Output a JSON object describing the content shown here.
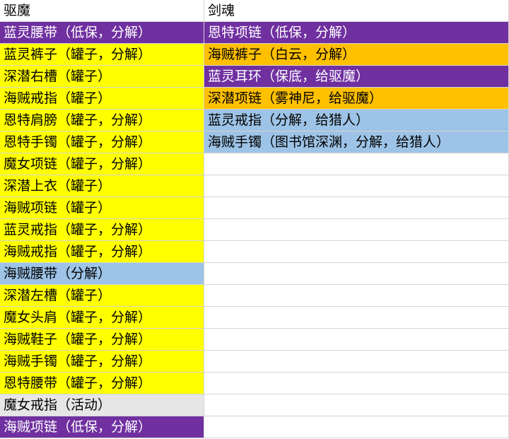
{
  "sheet": {
    "columns": [
      {
        "header": "驱魔",
        "cells": [
          {
            "text": "蓝灵腰带（低保，分解）",
            "fill": "#7030a0",
            "color": "#ffffff"
          },
          {
            "text": "蓝灵裤子（罐子，分解）",
            "fill": "#ffff00",
            "color": "#000000"
          },
          {
            "text": "深潜右槽（罐子）",
            "fill": "#ffff00",
            "color": "#000000"
          },
          {
            "text": "海贼戒指（罐子）",
            "fill": "#ffff00",
            "color": "#000000"
          },
          {
            "text": "恩特肩膀（罐子，分解）",
            "fill": "#ffff00",
            "color": "#000000"
          },
          {
            "text": "恩特手镯（罐子，分解）",
            "fill": "#ffff00",
            "color": "#000000"
          },
          {
            "text": "魔女项链（罐子，分解）",
            "fill": "#ffff00",
            "color": "#000000"
          },
          {
            "text": "深潜上衣（罐子）",
            "fill": "#ffff00",
            "color": "#000000"
          },
          {
            "text": "海贼项链（罐子）",
            "fill": "#ffff00",
            "color": "#000000"
          },
          {
            "text": "蓝灵戒指（罐子，分解）",
            "fill": "#ffff00",
            "color": "#000000"
          },
          {
            "text": "海贼戒指（罐子，分解）",
            "fill": "#ffff00",
            "color": "#000000"
          },
          {
            "text": "海贼腰带（分解）",
            "fill": "#9dc3e6",
            "color": "#000000"
          },
          {
            "text": "深潜左槽（罐子）",
            "fill": "#ffff00",
            "color": "#000000"
          },
          {
            "text": "魔女头肩（罐子，分解）",
            "fill": "#ffff00",
            "color": "#000000"
          },
          {
            "text": "海贼鞋子（罐子，分解）",
            "fill": "#ffff00",
            "color": "#000000"
          },
          {
            "text": "海贼手镯（罐子，分解）",
            "fill": "#ffff00",
            "color": "#000000"
          },
          {
            "text": "恩特腰带（罐子，分解）",
            "fill": "#ffff00",
            "color": "#000000"
          },
          {
            "text": "魔女戒指（活动）",
            "fill": "#e7e6e6",
            "color": "#000000"
          },
          {
            "text": "海贼项链（低保，分解）",
            "fill": "#7030a0",
            "color": "#ffffff"
          }
        ]
      },
      {
        "header": "剑魂",
        "cells": [
          {
            "text": "恩特项链（低保，分解）",
            "fill": "#7030a0",
            "color": "#ffffff"
          },
          {
            "text": "海贼裤子（白云，分解）",
            "fill": "#ffc000",
            "color": "#000000"
          },
          {
            "text": "蓝灵耳环（保底，给驱魔）",
            "fill": "#7030a0",
            "color": "#ffffff"
          },
          {
            "text": "深潜项链（雾神尼，给驱魔）",
            "fill": "#ffc000",
            "color": "#000000"
          },
          {
            "text": "蓝灵戒指（分解，给猎人）",
            "fill": "#9dc3e6",
            "color": "#000000"
          },
          {
            "text": "海贼手镯（图书馆深渊，分解，给猎人）",
            "fill": "#9dc3e6",
            "color": "#000000"
          },
          {
            "text": "",
            "fill": "#ffffff",
            "color": "#000000"
          },
          {
            "text": "",
            "fill": "#ffffff",
            "color": "#000000"
          },
          {
            "text": "",
            "fill": "#ffffff",
            "color": "#000000"
          },
          {
            "text": "",
            "fill": "#ffffff",
            "color": "#000000"
          },
          {
            "text": "",
            "fill": "#ffffff",
            "color": "#000000"
          },
          {
            "text": "",
            "fill": "#ffffff",
            "color": "#000000"
          },
          {
            "text": "",
            "fill": "#ffffff",
            "color": "#000000"
          },
          {
            "text": "",
            "fill": "#ffffff",
            "color": "#000000"
          },
          {
            "text": "",
            "fill": "#ffffff",
            "color": "#000000"
          },
          {
            "text": "",
            "fill": "#ffffff",
            "color": "#000000"
          },
          {
            "text": "",
            "fill": "#ffffff",
            "color": "#000000"
          },
          {
            "text": "",
            "fill": "#ffffff",
            "color": "#000000"
          },
          {
            "text": "",
            "fill": "#ffffff",
            "color": "#000000"
          }
        ]
      }
    ]
  }
}
